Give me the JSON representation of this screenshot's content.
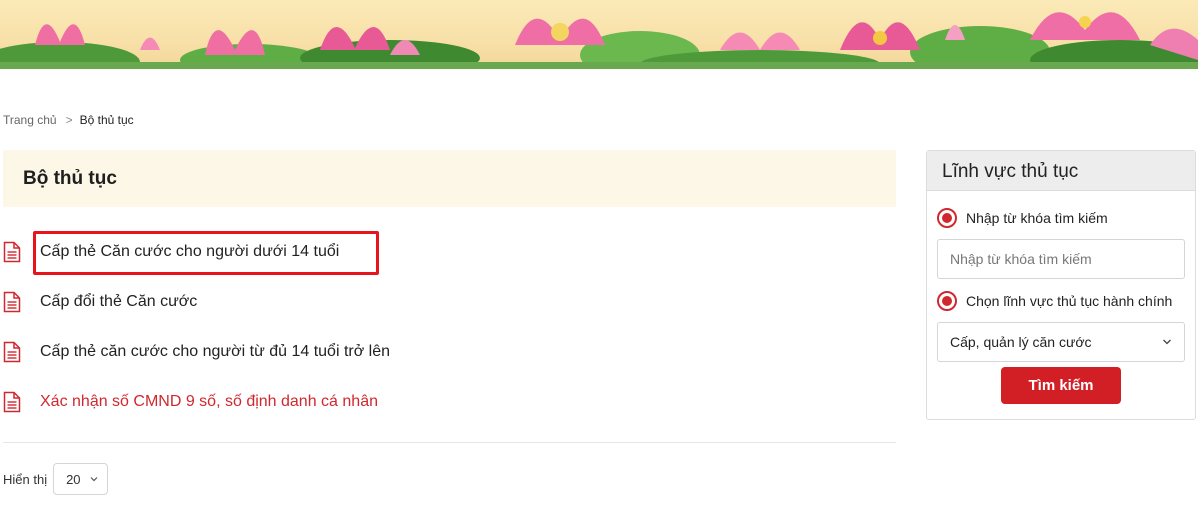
{
  "breadcrumb": {
    "home": "Trang chủ",
    "separator": ">",
    "current": "Bộ thủ tục"
  },
  "main": {
    "title": "Bộ thủ tục",
    "items": [
      {
        "label": "Cấp thẻ Căn cước cho người dưới 14 tuổi",
        "icon": "document-icon"
      },
      {
        "label": "Cấp đổi thẻ Căn cước",
        "icon": "document-icon"
      },
      {
        "label": "Cấp thẻ căn cước cho người từ đủ 14 tuổi trở lên",
        "icon": "document-icon"
      },
      {
        "label": "Xác nhận số CMND 9 số, số định danh cá nhân",
        "icon": "document-icon"
      }
    ]
  },
  "pager": {
    "label": "Hiển thị",
    "page_size": "20"
  },
  "sidebar": {
    "title": "Lĩnh vực thủ tục",
    "keyword_option": "Nhập từ khóa tìm kiếm",
    "keyword_placeholder": "Nhập từ khóa tìm kiếm",
    "field_option": "Chọn lĩnh vực thủ tục hành chính",
    "field_selected": "Cấp, quản lý căn cước",
    "search_button": "Tìm kiếm"
  },
  "colors": {
    "accent_red": "#d21f26",
    "header_bg": "#fcf7e6",
    "focus_outline": "#e8141c"
  }
}
